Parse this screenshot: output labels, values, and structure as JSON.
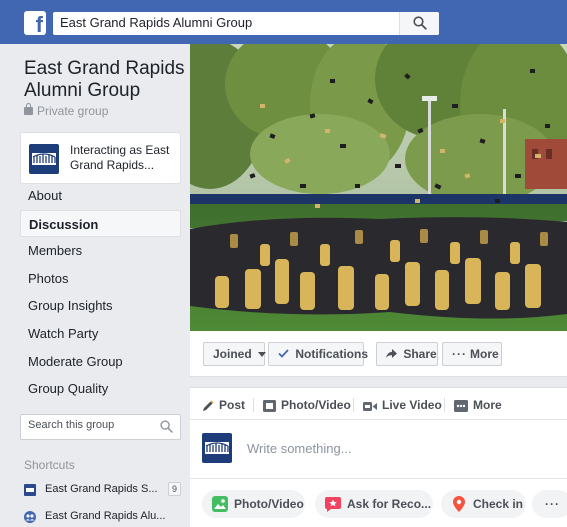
{
  "topbar": {
    "logo_letter": "f",
    "search_value": "East Grand Rapids Alumni Group"
  },
  "group": {
    "title_line1": "East Grand Rapids",
    "title_line2": "Alumni Group",
    "privacy": "Private group",
    "interacting_line1": "Interacting as East",
    "interacting_line2": "Grand Rapids..."
  },
  "nav": {
    "items": [
      {
        "label": "About"
      },
      {
        "label": "Discussion"
      },
      {
        "label": "Members"
      },
      {
        "label": "Photos"
      },
      {
        "label": "Group Insights"
      },
      {
        "label": "Watch Party"
      },
      {
        "label": "Moderate Group"
      },
      {
        "label": "Group Quality"
      }
    ]
  },
  "group_search": {
    "placeholder": "Search this group"
  },
  "shortcuts": {
    "heading": "Shortcuts",
    "items": [
      {
        "label": "East Grand Rapids S...",
        "badge": "9"
      },
      {
        "label": "East Grand Rapids Alu..."
      }
    ]
  },
  "actions": {
    "joined": "Joined",
    "notifications": "Notifications",
    "share": "Share",
    "more": "More"
  },
  "composer": {
    "tabs": {
      "post": "Post",
      "photo_video": "Photo/Video",
      "live_video": "Live Video",
      "more": "More"
    },
    "placeholder": "Write something...",
    "bottom": {
      "photo_video": "Photo/Video",
      "ask": "Ask for Reco...",
      "checkin": "Check in",
      "more": "···"
    }
  },
  "colors": {
    "brand": "#4267b2",
    "accent": "#4267b2",
    "background": "#e9ebee"
  }
}
